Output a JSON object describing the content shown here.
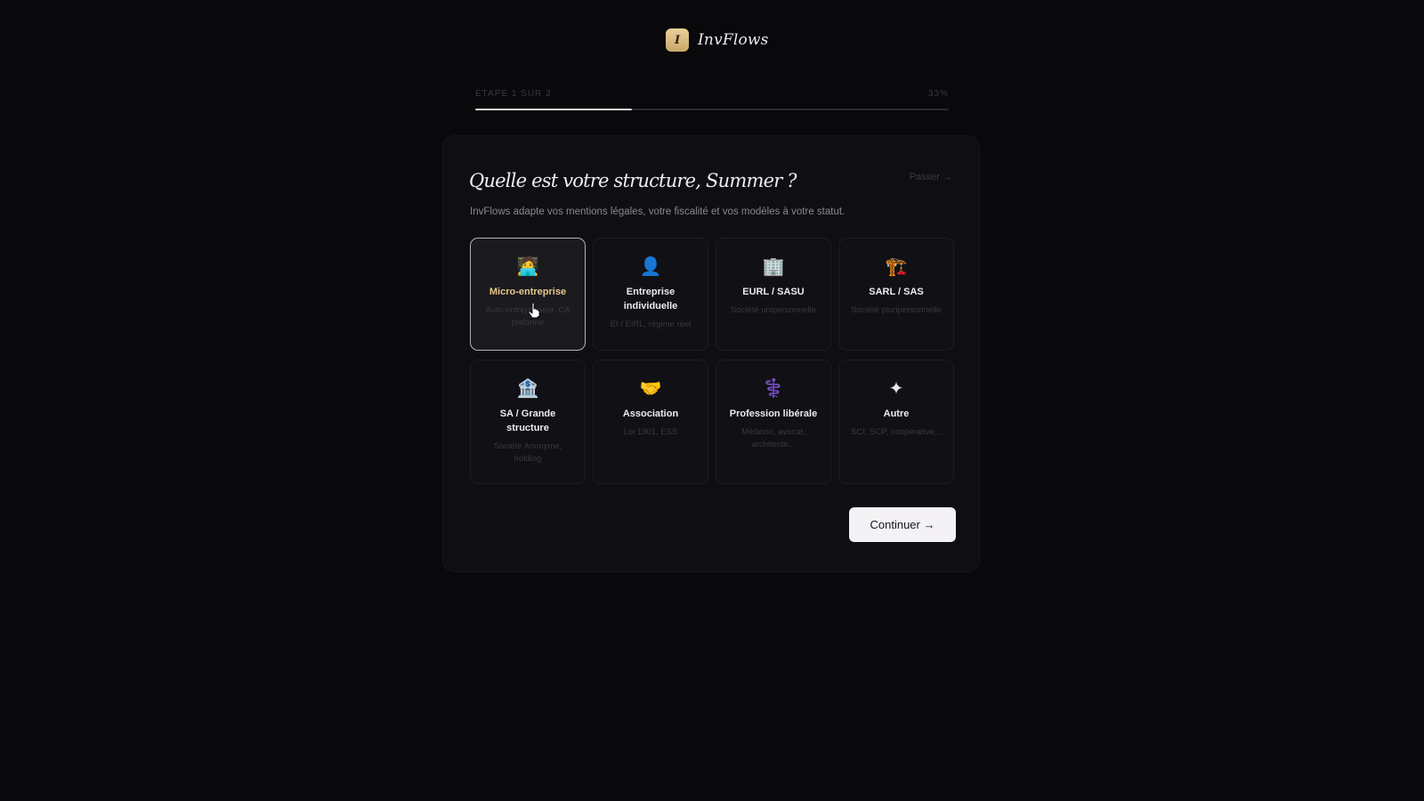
{
  "app": {
    "logo_letter": "I",
    "name": "InvFlows"
  },
  "progress": {
    "step_label": "ÉTAPE 1 SUR 3",
    "percent_label": "33%",
    "fraction": 0.33
  },
  "card": {
    "skip_label": "Passer →",
    "title": "Quelle est votre structure, Summer ?",
    "subtitle": "InvFlows adapte vos mentions légales, votre fiscalité et vos modèles à votre statut.",
    "continue_label": "Continuer →"
  },
  "options": [
    {
      "icon": "person-laptop-icon",
      "glyph": "🧑‍💻",
      "label": "Micro-entreprise",
      "description": "Auto-entrepreneur, CA plafonné",
      "selected": true
    },
    {
      "icon": "person-icon",
      "glyph": "👤",
      "label": "Entreprise individuelle",
      "description": "EI / EIRL, régime réel",
      "selected": false
    },
    {
      "icon": "office-building-icon",
      "glyph": "🏢",
      "label": "EURL / SASU",
      "description": "Société unipersonnelle",
      "selected": false
    },
    {
      "icon": "construction-icon",
      "glyph": "🏗️",
      "label": "SARL / SAS",
      "description": "Société pluripersonnelle",
      "selected": false
    },
    {
      "icon": "bank-icon",
      "glyph": "🏦",
      "label": "SA / Grande structure",
      "description": "Société Anonyme, holding",
      "selected": false
    },
    {
      "icon": "handshake-icon",
      "glyph": "🤝",
      "label": "Association",
      "description": "Loi 1901, ESS",
      "selected": false
    },
    {
      "icon": "medical-icon",
      "glyph": "⚕️",
      "label": "Profession libérale",
      "description": "Médecin, avocat, architecte...",
      "selected": false
    },
    {
      "icon": "sparkle-icon",
      "glyph": "✦",
      "label": "Autre",
      "description": "SCI, SCP, coopérative...",
      "selected": false
    }
  ],
  "colors": {
    "background": "#09080b",
    "card": "#0f0e12",
    "accent_gold": "#e6c98a",
    "button": "#f4f2f5"
  }
}
